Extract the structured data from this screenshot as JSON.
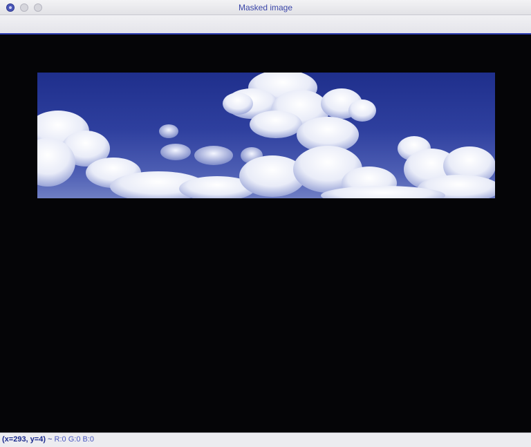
{
  "window": {
    "title": "Masked image"
  },
  "image": {
    "description_icon": "cloud-sky-image"
  },
  "status": {
    "coords": "(x=293, y=4)",
    "separator": " ~ ",
    "rgb": "R:0 G:0 B:0"
  },
  "colors": {
    "accent": "#2b3bb0",
    "background": "#050505"
  }
}
